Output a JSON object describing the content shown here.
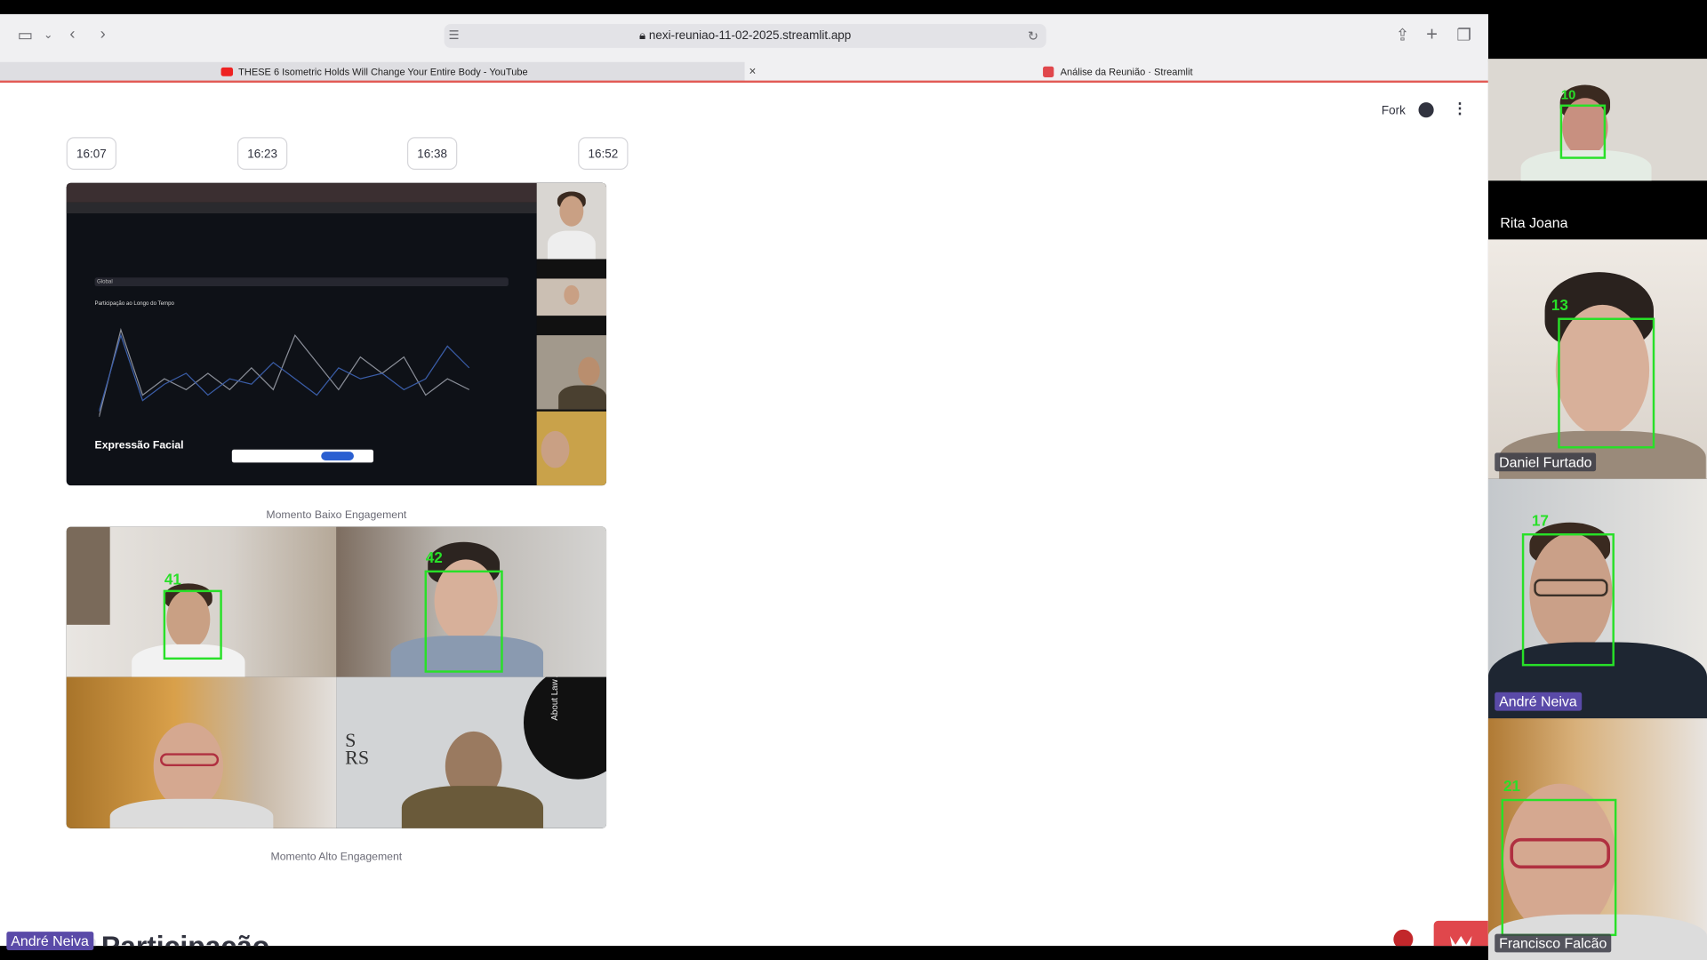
{
  "browser": {
    "url": "nexi-reuniao-11-02-2025.streamlit.app",
    "tabs": [
      {
        "title": "THESE 6 Isometric Holds Will Change Your Entire Body - YouTube",
        "active": false
      },
      {
        "title": "Análise da Reunião · Streamlit",
        "active": true
      }
    ]
  },
  "app_header": {
    "fork_label": "Fork"
  },
  "time_buttons": [
    "16:07",
    "16:23",
    "16:38",
    "16:52"
  ],
  "screenshot1": {
    "caption": "Momento Baixo Engagement",
    "inner_title": "Expressão Facial",
    "inner_chart_title": "Participação ao Longo do Tempo",
    "inner_select_value": "Global"
  },
  "screenshot2": {
    "caption": "Momento Alto Engagement",
    "face_ids": [
      "41",
      "42"
    ],
    "logo_text": "S\nRS",
    "banner_text": "About Law Around People"
  },
  "section_heading": "Participação",
  "participants": [
    {
      "name": "Rita Joana",
      "face_id": "10"
    },
    {
      "name": "Daniel Furtado",
      "face_id": "13"
    },
    {
      "name": "André Neiva",
      "face_id": "17"
    },
    {
      "name": "Francisco Falcão",
      "face_id": "21"
    }
  ],
  "self_label": "André Neiva",
  "colors": {
    "accent_red": "#e0474c",
    "face_box": "#28e028"
  }
}
